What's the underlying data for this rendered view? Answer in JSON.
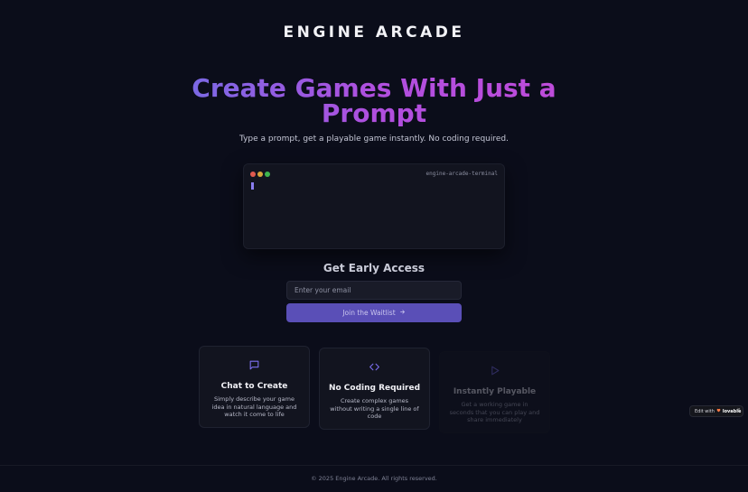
{
  "header": {
    "brand": "ENGINE ARCADE"
  },
  "hero": {
    "title": "Create Games With Just a Prompt",
    "subtitle": "Type a prompt, get a playable game instantly. No coding required."
  },
  "terminal": {
    "title": "engine-arcade-terminal"
  },
  "waitlist": {
    "heading": "Get Early Access",
    "email_placeholder": "Enter your email",
    "button_label": "Join the Waitlist",
    "button_icon": "arrow-right-icon"
  },
  "features": [
    {
      "icon": "chat-bubble-icon",
      "title": "Chat to Create",
      "description": "Simply describe your game idea in natural language and watch it come to life"
    },
    {
      "icon": "code-brackets-icon",
      "title": "No Coding Required",
      "description": "Create complex games without writing a single line of code"
    },
    {
      "icon": "play-icon",
      "title": "Instantly Playable",
      "description": "Get a working game in seconds that you can play and share immediately"
    }
  ],
  "badge": {
    "prefix": "Edit with",
    "brand": "lovable"
  },
  "footer": {
    "text": "© 2025 Engine Arcade. All rights reserved."
  },
  "colors": {
    "background": "#0b0d1a",
    "accent": "#5a4fb7",
    "gradient_start": "#6f6fe6",
    "gradient_end": "#c14bd9"
  }
}
